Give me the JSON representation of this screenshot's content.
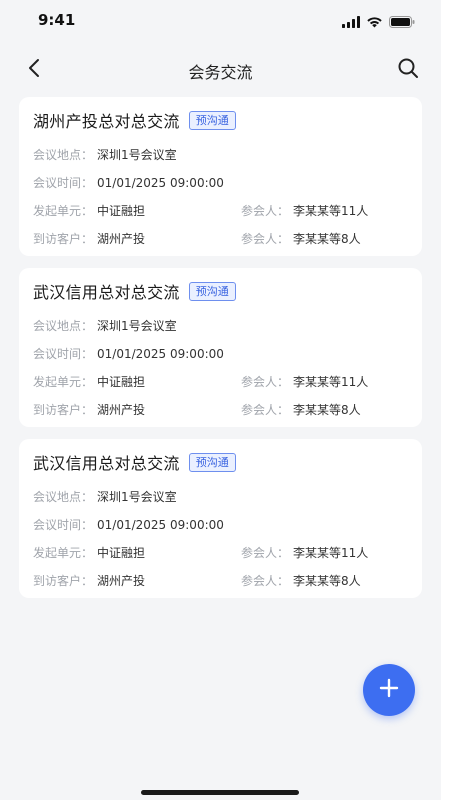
{
  "status_bar": {
    "time": "9:41"
  },
  "nav": {
    "title": "会务交流"
  },
  "meetings": [
    {
      "title": "湖州产投总对总交流",
      "tag": "预沟通",
      "location_label": "会议地点：",
      "location": "深圳1号会议室",
      "time_label": "会议时间：",
      "time": "01/01/2025 09:00:00",
      "initiator_label": "发起单元：",
      "initiator": "中证融担",
      "participants_label": "参会人：",
      "participants": "李某某等11人",
      "client_label": "到访客户：",
      "client": "湖州产投",
      "client_participants_label": "参会人：",
      "client_participants": "李某某等8人"
    },
    {
      "title": "武汉信用总对总交流",
      "tag": "预沟通",
      "location_label": "会议地点：",
      "location": "深圳1号会议室",
      "time_label": "会议时间：",
      "time": "01/01/2025 09:00:00",
      "initiator_label": "发起单元：",
      "initiator": "中证融担",
      "participants_label": "参会人：",
      "participants": "李某某等11人",
      "client_label": "到访客户：",
      "client": "湖州产投",
      "client_participants_label": "参会人：",
      "client_participants": "李某某等8人"
    },
    {
      "title": "武汉信用总对总交流",
      "tag": "预沟通",
      "location_label": "会议地点：",
      "location": "深圳1号会议室",
      "time_label": "会议时间：",
      "time": "01/01/2025 09:00:00",
      "initiator_label": "发起单元：",
      "initiator": "中证融担",
      "participants_label": "参会人：",
      "participants": "李某某等11人",
      "client_label": "到访客户：",
      "client": "湖州产投",
      "client_participants_label": "参会人：",
      "client_participants": "李某某等8人"
    }
  ],
  "icons": {
    "back": "chevron-left-icon",
    "search": "search-icon",
    "add": "plus-icon",
    "signal": "signal-icon",
    "wifi": "wifi-icon",
    "battery": "battery-icon"
  },
  "colors": {
    "accent": "#3d6ef1",
    "tag_text": "#3a64e0",
    "tag_bg": "#eaf0ff",
    "page_bg": "#f4f5f7",
    "label_gray": "#a0a4ab"
  }
}
